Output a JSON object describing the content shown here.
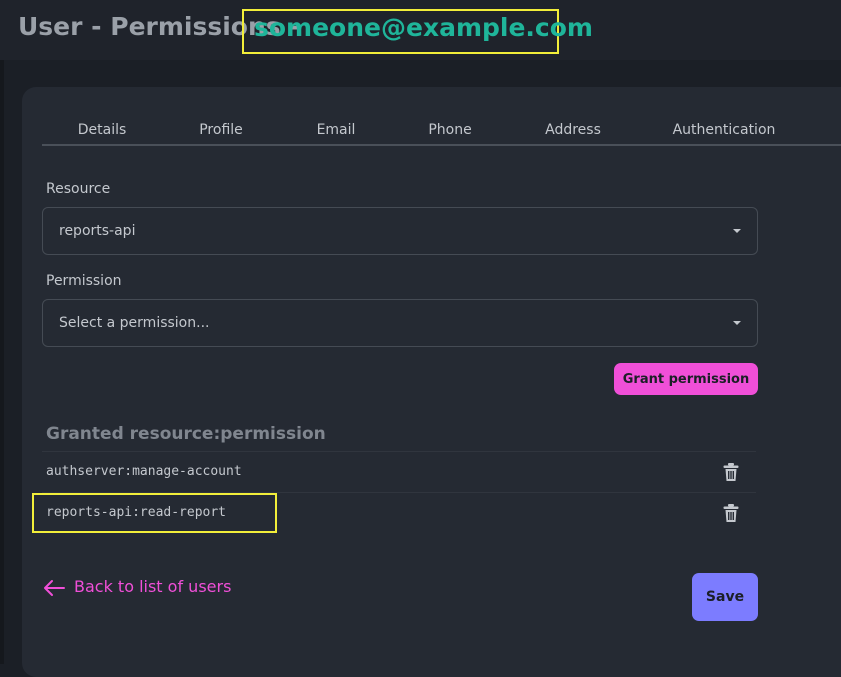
{
  "header": {
    "title": "User - Permissions",
    "separator": "-",
    "email": "someone@example.com"
  },
  "tabs": [
    {
      "label": "Details"
    },
    {
      "label": "Profile"
    },
    {
      "label": "Email"
    },
    {
      "label": "Phone"
    },
    {
      "label": "Address"
    },
    {
      "label": "Authentication"
    }
  ],
  "form": {
    "resource_label": "Resource",
    "resource_value": "reports-api",
    "permission_label": "Permission",
    "permission_placeholder": "Select a permission...",
    "grant_button": "Grant permission"
  },
  "granted": {
    "heading": "Granted resource:permission",
    "items": [
      {
        "text": "authserver:manage-account",
        "icon": "trash-icon"
      },
      {
        "text": "reports-api:read-report",
        "icon": "trash-icon"
      }
    ]
  },
  "footer": {
    "back_label": "Back to list of users",
    "back_icon": "arrow-left-icon",
    "save_button": "Save"
  },
  "colors": {
    "background": "#1b1f26",
    "card": "#252a33",
    "accent_pink": "#f04fd8",
    "accent_teal": "#1fb59a",
    "save_purple": "#7c7cff",
    "highlight": "#f2ee3a"
  }
}
